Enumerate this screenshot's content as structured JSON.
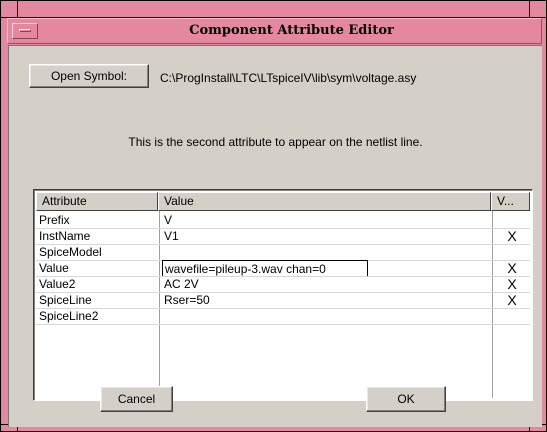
{
  "window": {
    "title": "Component Attribute Editor"
  },
  "toolbar": {
    "open_symbol_label": "Open Symbol:",
    "symbol_path": "C:\\ProgInstall\\LTC\\LTspiceIV\\lib\\sym\\voltage.asy"
  },
  "description": "This is the second attribute to appear on the netlist line.",
  "table": {
    "headers": {
      "attribute": "Attribute",
      "value": "Value",
      "visible": "V..."
    },
    "rows": [
      {
        "attribute": "Prefix",
        "value": "V",
        "visible": ""
      },
      {
        "attribute": "InstName",
        "value": "V1",
        "visible": "X"
      },
      {
        "attribute": "SpiceModel",
        "value": "",
        "visible": ""
      },
      {
        "attribute": "Value",
        "value": "wavefile=pileup-3.wav chan=0",
        "visible": "X"
      },
      {
        "attribute": "Value2",
        "value": "AC 2V",
        "visible": "X"
      },
      {
        "attribute": "SpiceLine",
        "value": "Rser=50",
        "visible": "X"
      },
      {
        "attribute": "SpiceLine2",
        "value": "",
        "visible": ""
      }
    ]
  },
  "buttons": {
    "cancel": "Cancel",
    "ok": "OK"
  },
  "colors": {
    "title_bar": "#e3889e",
    "dialog_bg": "#d4d0c8"
  }
}
